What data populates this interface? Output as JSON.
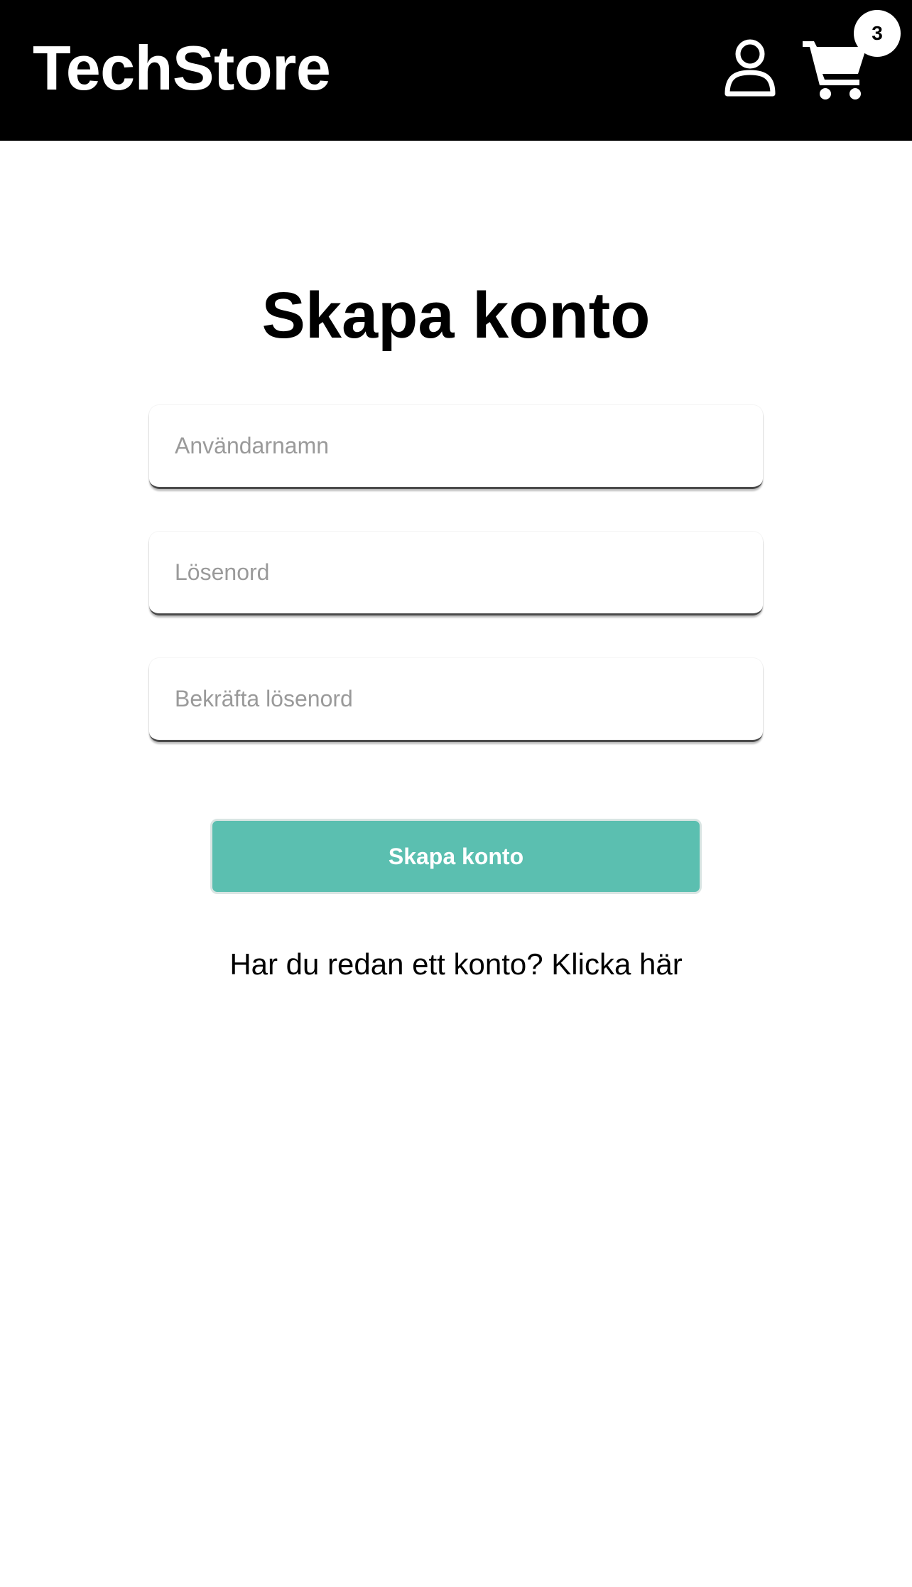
{
  "header": {
    "brand": "TechStore",
    "user_icon": "user-icon",
    "cart_icon": "cart-icon",
    "cart_count": "3"
  },
  "main": {
    "title": "Skapa konto",
    "fields": {
      "username": {
        "placeholder": "Användarnamn",
        "value": ""
      },
      "password": {
        "placeholder": "Lösenord",
        "value": ""
      },
      "confirm_password": {
        "placeholder": "Bekräfta lösenord",
        "value": ""
      }
    },
    "submit_label": "Skapa konto",
    "login_prompt": "Har du redan ett konto? Klicka här"
  },
  "colors": {
    "header_bg": "#000000",
    "accent": "#5bbfb0",
    "text": "#000000",
    "placeholder": "#9a9a9a"
  }
}
